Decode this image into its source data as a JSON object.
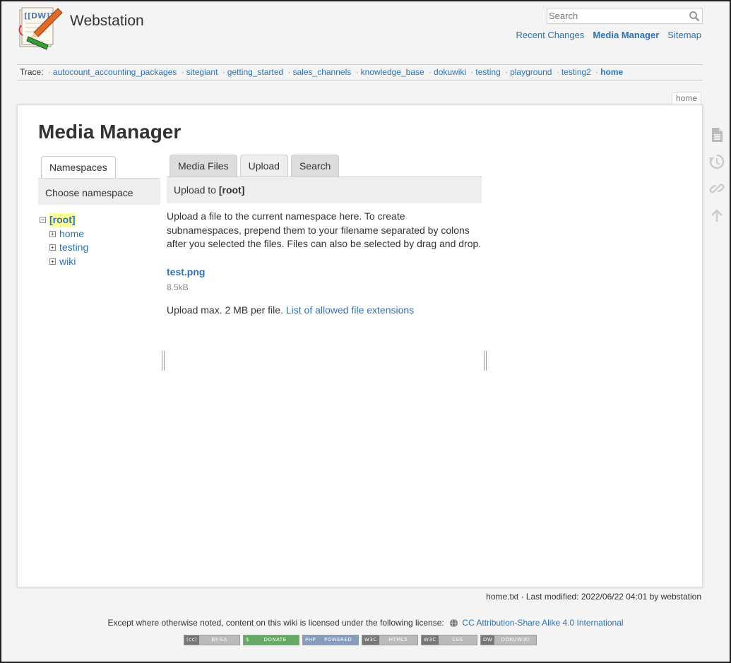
{
  "header": {
    "site_title": "Webstation",
    "logo_text": "[[DW]]",
    "search_placeholder": "Search",
    "user_tools": [
      {
        "label": "Recent Changes",
        "active": false
      },
      {
        "label": "Media Manager",
        "active": true
      },
      {
        "label": "Sitemap",
        "active": false
      }
    ]
  },
  "trace": {
    "label": "Trace:",
    "items": [
      "autocount_accounting_packages",
      "sitegiant",
      "getting_started",
      "sales_channels",
      "knowledge_base",
      "dokuwiki",
      "testing",
      "playground",
      "testing2",
      "home"
    ]
  },
  "page_id": "home",
  "main": {
    "title": "Media Manager",
    "namespaces": {
      "tab_label": "Namespaces",
      "heading": "Choose namespace",
      "root": "[root]",
      "children": [
        "home",
        "testing",
        "wiki"
      ]
    },
    "files": {
      "tabs": [
        "Media Files",
        "Upload",
        "Search"
      ],
      "active_tab": "Upload",
      "heading_prefix": "Upload to",
      "heading_ns": "[root]",
      "description": "Upload a file to the current namespace here. To create subnamespaces, prepend them to your filename separated by colons after you selected the files. Files can also be selected by drag and drop.",
      "file_name": "test.png",
      "file_size": "8.5kB",
      "upload_max_text": "Upload max. 2 MB per file.",
      "allowed_link": "List of allowed file extensions"
    }
  },
  "footer": {
    "doc_info": "home.txt · Last modified: 2022/06/22 04:01 by webstation",
    "license_text": "Except where otherwise noted, content on this wiki is licensed under the following license:",
    "license_link": "CC Attribution-Share Alike 4.0 International",
    "badges": [
      {
        "left": "(cc)",
        "right": "BY-SA"
      },
      {
        "left": "$",
        "right": "DONATE"
      },
      {
        "left": "PHP",
        "right": "POWERED"
      },
      {
        "left": "W3C",
        "right": "HTML5"
      },
      {
        "left": "W3C",
        "right": "CSS"
      },
      {
        "left": "DW",
        "right": "DOKUWIKI"
      }
    ]
  }
}
